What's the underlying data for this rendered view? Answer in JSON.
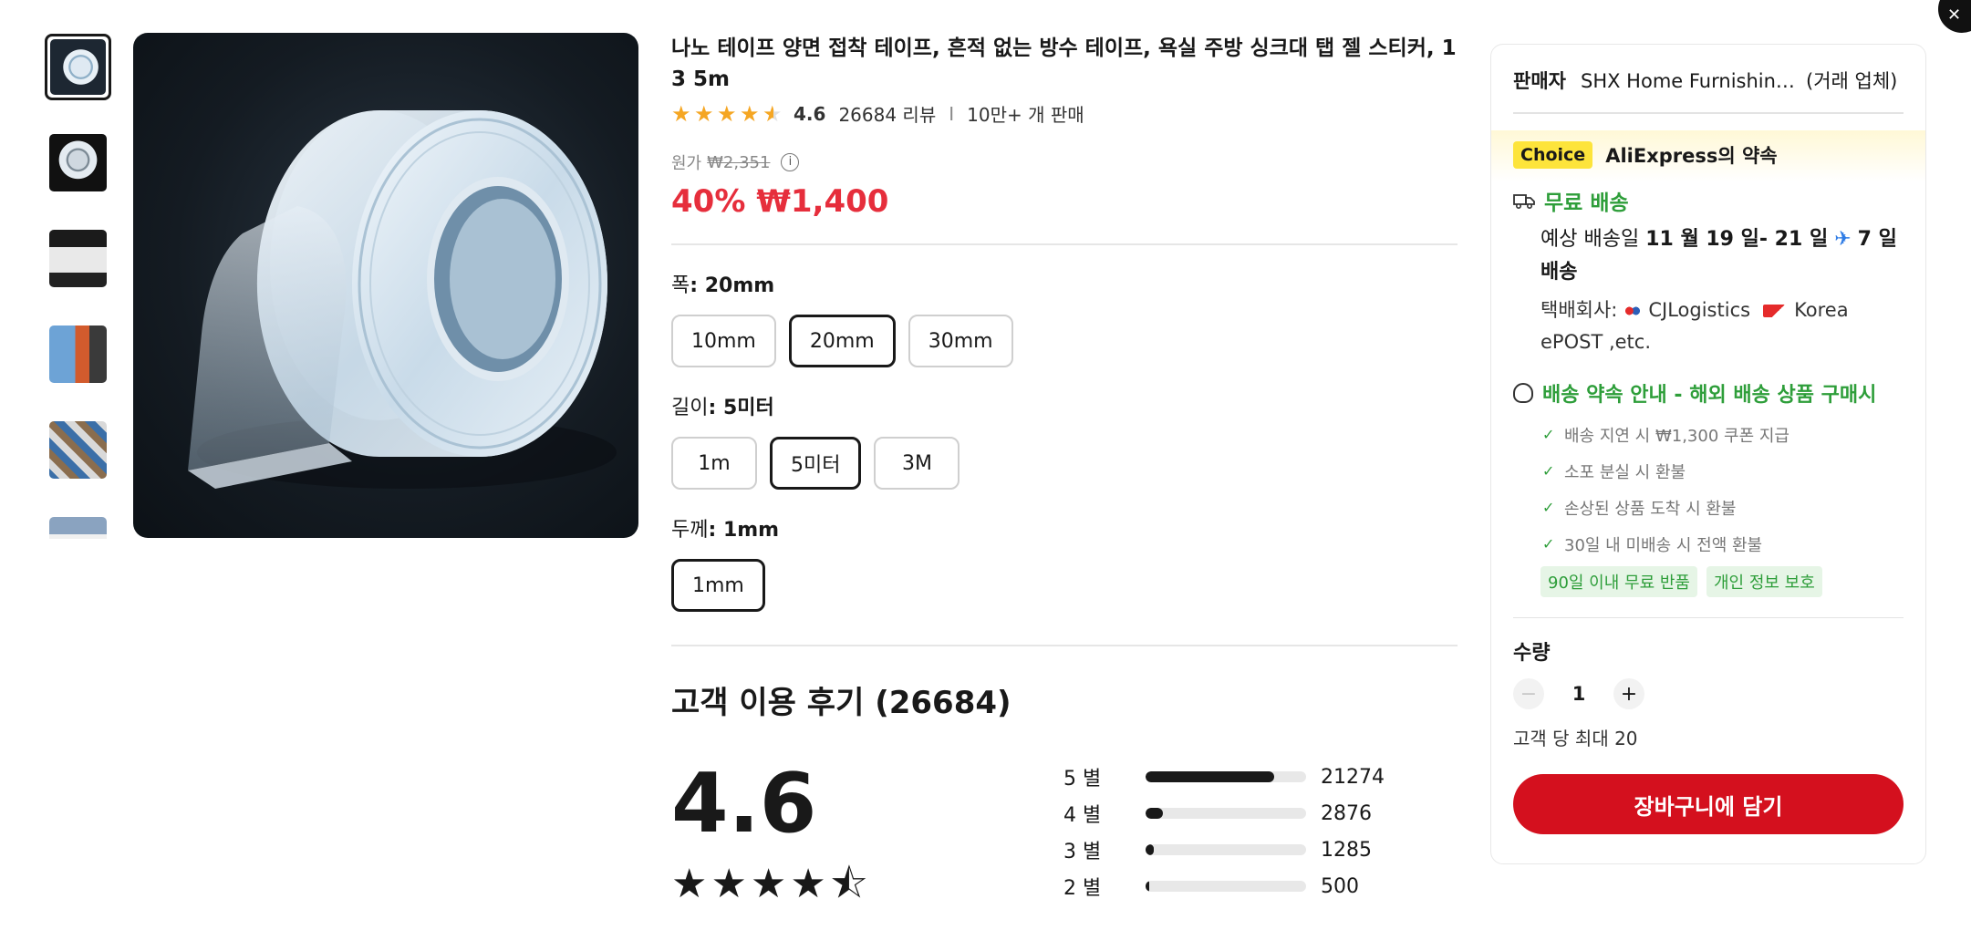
{
  "product": {
    "title": "나노 테이프 양면 접착 테이프, 흔적 없는 방수 테이프, 욕실 주방 싱크대 탭 젤 스티커, 1 3 5m",
    "rating": "4.6",
    "reviews": "26684 리뷰",
    "sep": "I",
    "sold": "10만+ 개 판매",
    "orig_label": "원가",
    "orig_price": "₩2,351",
    "discount": "40%",
    "price": "₩1,400"
  },
  "options": {
    "width": {
      "label": "폭",
      "value": "20mm",
      "choices": [
        "10mm",
        "20mm",
        "30mm"
      ]
    },
    "length": {
      "label": "길이",
      "value": "5미터",
      "choices": [
        "1m",
        "5미터",
        "3M"
      ]
    },
    "thickness": {
      "label": "두께",
      "value": "1mm",
      "choices": [
        "1mm"
      ]
    }
  },
  "reviews_section": {
    "title": "고객 이용 후기 (26684)",
    "score": "4.6",
    "distribution": [
      {
        "label": "5 별",
        "count": "21274",
        "fraction": 0.8
      },
      {
        "label": "4 별",
        "count": "2876",
        "fraction": 0.11
      },
      {
        "label": "3 별",
        "count": "1285",
        "fraction": 0.05
      },
      {
        "label": "2 별",
        "count": "500",
        "fraction": 0.02
      }
    ]
  },
  "panel": {
    "seller_label": "판매자",
    "seller_name": "SHX Home Furnishing St...",
    "seller_type": "(거래 업체)",
    "choice_badge": "Choice",
    "choice_text": "AliExpress의 약속",
    "free_shipping": "무료 배송",
    "delivery_prefix": "예상 배송일",
    "delivery_dates": "11 월 19 일- 21 일",
    "delivery_days": "7 일 배송",
    "carrier_label": "택배회사:",
    "carrier_1": "CJLogistics",
    "carrier_2": "Korea ePOST ,etc.",
    "promise_title": "배송 약속 안내 - 해외 배송 상품 구매시",
    "promises": [
      "배송 지연 시 ₩1,300 쿠폰 지급",
      "소포 분실 시 환불",
      "손상된 상품 도착 시 환불",
      "30일 내 미배송 시 전액 환불"
    ],
    "tag_1": "90일 이내 무료 반품",
    "tag_2": "개인 정보 보호",
    "qty_label": "수량",
    "qty_value": "1",
    "qty_max": "고객 당 최대 20",
    "cart_button": "장바구니에 담기"
  },
  "colors": {
    "price_red": "#e62e3c",
    "cart_red": "#d4101e",
    "green": "#2e9e3a",
    "star_gold": "#f5a623"
  }
}
